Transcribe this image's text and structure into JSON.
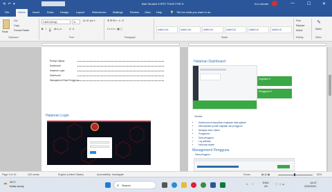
{
  "titlebar": {
    "document_title": "Bab Struktur 5 RPS TOUR FOR D",
    "user": "Ku Lukman",
    "min": "—",
    "max": "☐",
    "close": "✕"
  },
  "tabs": [
    "File",
    "Home",
    "Insert",
    "Draw",
    "Design",
    "Layout",
    "References",
    "Mailings",
    "Review",
    "View",
    "Help"
  ],
  "tell_me": "Tell me what you want to do",
  "ribbon": {
    "cut": "Cut",
    "copy": "Copy",
    "format_painter": "Format Painter",
    "paste": "Paste",
    "font_name": "Calibri (Body)",
    "font_size": "11",
    "find": "Find",
    "replace": "Replace",
    "select": "Select",
    "editor": "Editor",
    "groups": {
      "clipboard": "Clipboard",
      "font": "Font",
      "paragraph": "Paragraph",
      "styles": "Styles",
      "editing": "Editing",
      "editor": "Editor"
    },
    "styles": [
      "AaBbCcDc",
      "AaBbCcDc",
      "AaBbCcD",
      "AaBbCcD",
      "AaBbCcD",
      "AaBbCcD"
    ]
  },
  "toc": [
    "Ruang Lingkup",
    "Dashboard",
    "Halaman Login",
    "Dashboard",
    "Management Data Pengguna"
  ],
  "left_page": {
    "heading": "Halaman Login"
  },
  "right_page": {
    "heading1": "Halaman Dashboard",
    "heading2": "Management Pengguna",
    "subtitle": "Data pengguna",
    "caption": "Gambar",
    "bullets": [
      "Dashboard menampilkan ringkasan data aplikasi",
      "Menampilkan jumlah kegiatan dan pengguna",
      "Navigasi menu utama",
      "Pengaturan",
      "Data pengguna",
      "Log aktivitas",
      "Informasi sistem"
    ],
    "card1": "Kegiatan",
    "card2": "Pengguna",
    "card1_value": "0",
    "card2_value": "0"
  },
  "statusbar": {
    "page": "Page 3 of 10",
    "words": "243 words",
    "language": "English (United States)",
    "accessibility": "Accessibility: Investigate",
    "focus": "Focus",
    "zoom": "50%"
  },
  "taskbar": {
    "weather_temp": "26°C",
    "weather_desc": "Mostly cloudy",
    "search": "Search",
    "lang": "ENG",
    "region": "US",
    "time": "14:07",
    "date": "22/01/2024"
  }
}
